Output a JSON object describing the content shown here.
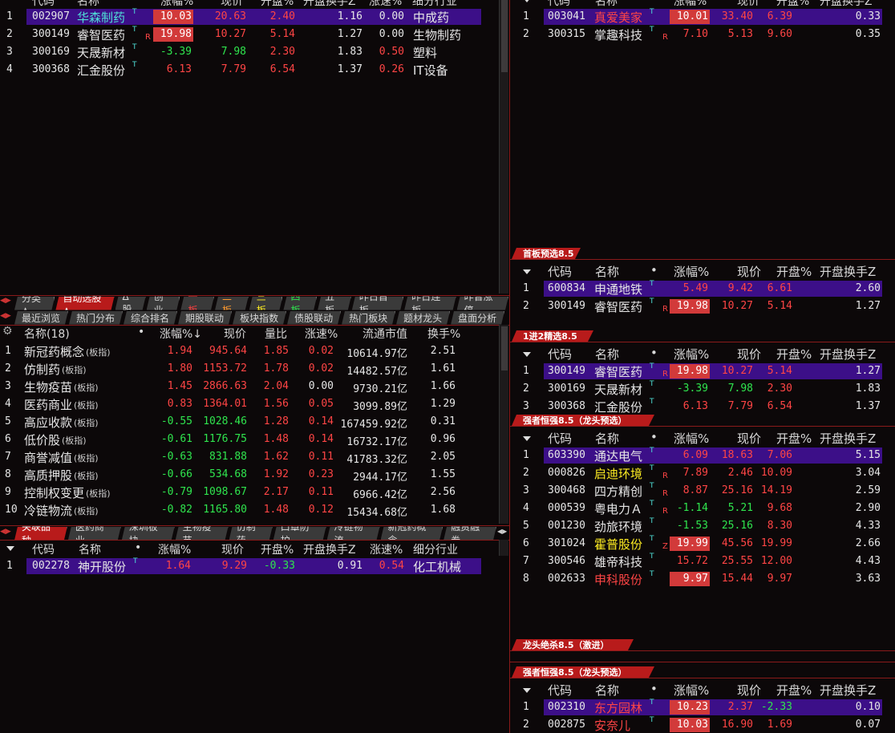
{
  "left_top": {
    "headers": [
      "代码",
      "名称",
      "涨幅%",
      "现价",
      "开盘%",
      "开盘换手Z",
      "涨速%",
      "细分行业"
    ],
    "rows": [
      {
        "idx": "1",
        "code": "002907",
        "name": "华森制药",
        "chg": "10.03",
        "price": "20.63",
        "open": "2.40",
        "turn": "1.16",
        "speed": "0.00",
        "industry": "中成药"
      },
      {
        "idx": "2",
        "code": "300149",
        "name": "睿智医药",
        "mark": "R",
        "chg": "19.98",
        "price": "10.27",
        "open": "5.14",
        "turn": "1.27",
        "speed": "0.00",
        "industry": "生物制药"
      },
      {
        "idx": "3",
        "code": "300169",
        "name": "天晟新材",
        "chg": "-3.39",
        "price": "7.98",
        "open": "2.30",
        "turn": "1.83",
        "speed": "0.50",
        "industry": "塑料"
      },
      {
        "idx": "4",
        "code": "300368",
        "name": "汇金股份",
        "chg": "6.13",
        "price": "7.79",
        "open": "6.54",
        "turn": "1.37",
        "speed": "0.26",
        "industry": "IT设备"
      }
    ]
  },
  "tabs1": [
    "分类▲",
    "自动选股▲",
    "Δ股",
    "创业",
    "一板",
    "二板",
    "三板",
    "四板",
    "五板",
    "昨日首板",
    "昨日连板",
    "昨曾涨停"
  ],
  "tabs2": [
    "最近浏览",
    "热门分布",
    "综合排名",
    "期股联动",
    "板块指数",
    "债股联动",
    "热门板块",
    "题材龙头",
    "盘面分析"
  ],
  "sector": {
    "headers": [
      "名称(18)",
      "•",
      "涨幅%↓",
      "现价",
      "量比",
      "涨速%",
      "流通市值",
      "换手%"
    ],
    "suffix": "(板指)",
    "rows": [
      {
        "idx": "1",
        "name": "新冠药概念",
        "chg": "1.94",
        "price": "945.64",
        "ratio": "1.85",
        "speed": "0.02",
        "cap": "10614.97亿",
        "turn": "2.51"
      },
      {
        "idx": "2",
        "name": "仿制药",
        "chg": "1.80",
        "price": "1153.72",
        "ratio": "1.78",
        "speed": "0.02",
        "cap": "14482.57亿",
        "turn": "1.61"
      },
      {
        "idx": "3",
        "name": "生物疫苗",
        "chg": "1.45",
        "price": "2866.63",
        "ratio": "2.04",
        "speed": "0.00",
        "cap": "9730.21亿",
        "turn": "1.66"
      },
      {
        "idx": "4",
        "name": "医药商业",
        "chg": "0.83",
        "price": "1364.01",
        "ratio": "1.56",
        "speed": "0.05",
        "cap": "3099.89亿",
        "turn": "1.29"
      },
      {
        "idx": "5",
        "name": "高应收款",
        "chg": "-0.55",
        "price": "1028.46",
        "ratio": "1.28",
        "speed": "0.14",
        "cap": "167459.92亿",
        "turn": "0.31"
      },
      {
        "idx": "6",
        "name": "低价股",
        "chg": "-0.61",
        "price": "1176.75",
        "ratio": "1.48",
        "speed": "0.14",
        "cap": "16732.17亿",
        "turn": "0.96"
      },
      {
        "idx": "7",
        "name": "商誉减值",
        "chg": "-0.63",
        "price": "831.88",
        "ratio": "1.62",
        "speed": "0.11",
        "cap": "41783.32亿",
        "turn": "2.05"
      },
      {
        "idx": "8",
        "name": "高质押股",
        "chg": "-0.66",
        "price": "534.68",
        "ratio": "1.92",
        "speed": "0.23",
        "cap": "2944.17亿",
        "turn": "1.55"
      },
      {
        "idx": "9",
        "name": "控制权变更",
        "chg": "-0.79",
        "price": "1098.67",
        "ratio": "2.17",
        "speed": "0.11",
        "cap": "6966.42亿",
        "turn": "2.56"
      },
      {
        "idx": "10",
        "name": "冷链物流",
        "chg": "-0.82",
        "price": "1165.80",
        "ratio": "1.48",
        "speed": "0.12",
        "cap": "15434.68亿",
        "turn": "1.68"
      }
    ]
  },
  "tabs3": [
    "关联品种",
    "医药商业",
    "深圳板块",
    "生物疫苗",
    "仿制药",
    "口罩防护",
    "冷链物流",
    "新冠药概念",
    "融资融券"
  ],
  "related": {
    "headers": [
      "代码",
      "名称",
      "•",
      "涨幅%",
      "现价",
      "开盘%",
      "开盘换手Z",
      "涨速%",
      "细分行业"
    ],
    "rows": [
      {
        "idx": "1",
        "code": "002278",
        "name": "神开股份",
        "chg": "1.64",
        "price": "9.29",
        "open": "-0.33",
        "turn": "0.91",
        "speed": "0.54",
        "industry": "化工机械"
      }
    ]
  },
  "right_top": {
    "headers": [
      "代码",
      "名称",
      "涨幅%",
      "现价",
      "开盘%",
      "开盘换手Z"
    ],
    "rows": [
      {
        "idx": "1",
        "code": "003041",
        "name": "真爱美家",
        "chg": "10.01",
        "price": "33.40",
        "open": "6.39",
        "turn": "0.33"
      },
      {
        "idx": "2",
        "code": "300315",
        "name": "掌趣科技",
        "mark": "R",
        "chg": "7.10",
        "price": "5.13",
        "open": "9.60",
        "turn": "0.35"
      }
    ]
  },
  "panel_headers": [
    "代码",
    "名称",
    "•",
    "涨幅%",
    "现价",
    "开盘%",
    "开盘换手Z"
  ],
  "panels": [
    {
      "title": "首板预选8.5",
      "rows": [
        {
          "idx": "1",
          "code": "600834",
          "name": "申通地铁",
          "chg": "5.49",
          "price": "9.42",
          "open": "6.61",
          "turn": "2.60"
        },
        {
          "idx": "2",
          "code": "300149",
          "name": "睿智医药",
          "mark": "R",
          "chg": "19.98",
          "price": "10.27",
          "open": "5.14",
          "turn": "1.27"
        }
      ]
    },
    {
      "title": "1进2精选8.5",
      "rows": [
        {
          "idx": "1",
          "code": "300149",
          "name": "睿智医药",
          "mark": "R",
          "chg": "19.98",
          "price": "10.27",
          "open": "5.14",
          "turn": "1.27"
        },
        {
          "idx": "2",
          "code": "300169",
          "name": "天晟新材",
          "chg": "-3.39",
          "price": "7.98",
          "open": "2.30",
          "turn": "1.83"
        },
        {
          "idx": "3",
          "code": "300368",
          "name": "汇金股份",
          "chg": "6.13",
          "price": "7.79",
          "open": "6.54",
          "turn": "1.37"
        }
      ]
    },
    {
      "title": "强者恒强8.5（龙头预选）",
      "rows": [
        {
          "idx": "1",
          "code": "603390",
          "name": "通达电气",
          "chg": "6.09",
          "price": "18.63",
          "open": "7.06",
          "turn": "5.15"
        },
        {
          "idx": "2",
          "code": "000826",
          "name": "启迪环境",
          "mark": "R",
          "chg": "7.89",
          "price": "2.46",
          "open": "10.09",
          "turn": "3.04"
        },
        {
          "idx": "3",
          "code": "300468",
          "name": "四方精创",
          "mark": "R",
          "chg": "8.87",
          "price": "25.16",
          "open": "14.19",
          "turn": "2.59"
        },
        {
          "idx": "4",
          "code": "000539",
          "name": "粤电力Ａ",
          "mark": "R",
          "chg": "-1.14",
          "price": "5.21",
          "open": "9.68",
          "turn": "2.90"
        },
        {
          "idx": "5",
          "code": "001230",
          "name": "劲旅环境",
          "chg": "-1.53",
          "price": "25.16",
          "open": "8.30",
          "turn": "4.33"
        },
        {
          "idx": "6",
          "code": "301024",
          "name": "霍普股份",
          "mark": "Z",
          "chg": "19.99",
          "price": "45.56",
          "open": "19.99",
          "turn": "2.66"
        },
        {
          "idx": "7",
          "code": "300546",
          "name": "雄帝科技",
          "chg": "15.72",
          "price": "25.55",
          "open": "12.00",
          "turn": "4.43"
        },
        {
          "idx": "8",
          "code": "002633",
          "name": "申科股份",
          "chg": "9.97",
          "price": "15.44",
          "open": "9.97",
          "turn": "3.63"
        }
      ]
    },
    {
      "title": "龙头绝杀8.5（激进）",
      "rows": []
    },
    {
      "title": "强者恒强8.5（龙头预选）",
      "rows": [
        {
          "idx": "1",
          "code": "002310",
          "name": "东方园林",
          "chg": "10.23",
          "price": "2.37",
          "open": "-2.33",
          "turn": "0.10"
        },
        {
          "idx": "2",
          "code": "002875",
          "name": "安奈儿",
          "chg": "10.03",
          "price": "16.90",
          "open": "1.69",
          "turn": "0.07"
        }
      ]
    }
  ],
  "colors": {
    "accent": "#b81b1b",
    "select": "#3c0f88",
    "up": "#ff4545",
    "down": "#2fe54e"
  }
}
